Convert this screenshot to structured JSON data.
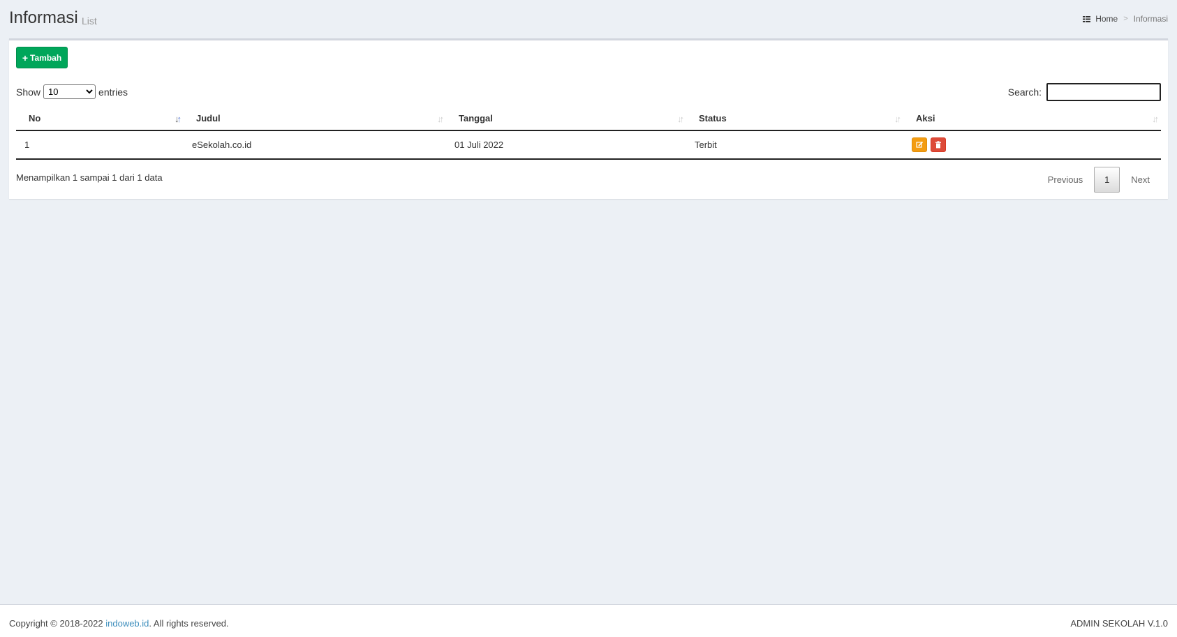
{
  "header": {
    "title": "Informasi",
    "subtitle": "List",
    "breadcrumb": {
      "home": "Home",
      "current": "Informasi",
      "separator": ">"
    }
  },
  "toolbar": {
    "add_label": "Tambah"
  },
  "length": {
    "prefix": "Show",
    "suffix": "entries",
    "selected": "10",
    "options": [
      "10"
    ]
  },
  "search": {
    "label": "Search:",
    "value": ""
  },
  "table": {
    "columns": [
      "No",
      "Judul",
      "Tanggal",
      "Status",
      "Aksi"
    ],
    "rows": [
      {
        "no": "1",
        "judul": "eSekolah.co.id",
        "tanggal": "01 Juli 2022",
        "status": "Terbit"
      }
    ]
  },
  "info": "Menampilkan 1 sampai 1 dari 1 data",
  "pagination": {
    "previous": "Previous",
    "current": "1",
    "next": "Next"
  },
  "footer": {
    "copy_prefix": "Copyright © 2018-2022 ",
    "copy_link": "indoweb.id",
    "copy_suffix": ". All rights reserved.",
    "version": "ADMIN SEKOLAH V.1.0"
  },
  "colors": {
    "add": "#00a65a",
    "edit": "#f39c12",
    "delete": "#dd4b39",
    "link": "#3c8dbc"
  },
  "icons": {
    "add": "plus-icon",
    "edit": "edit-icon",
    "delete": "trash-icon",
    "breadcrumb": "grid-icon"
  }
}
